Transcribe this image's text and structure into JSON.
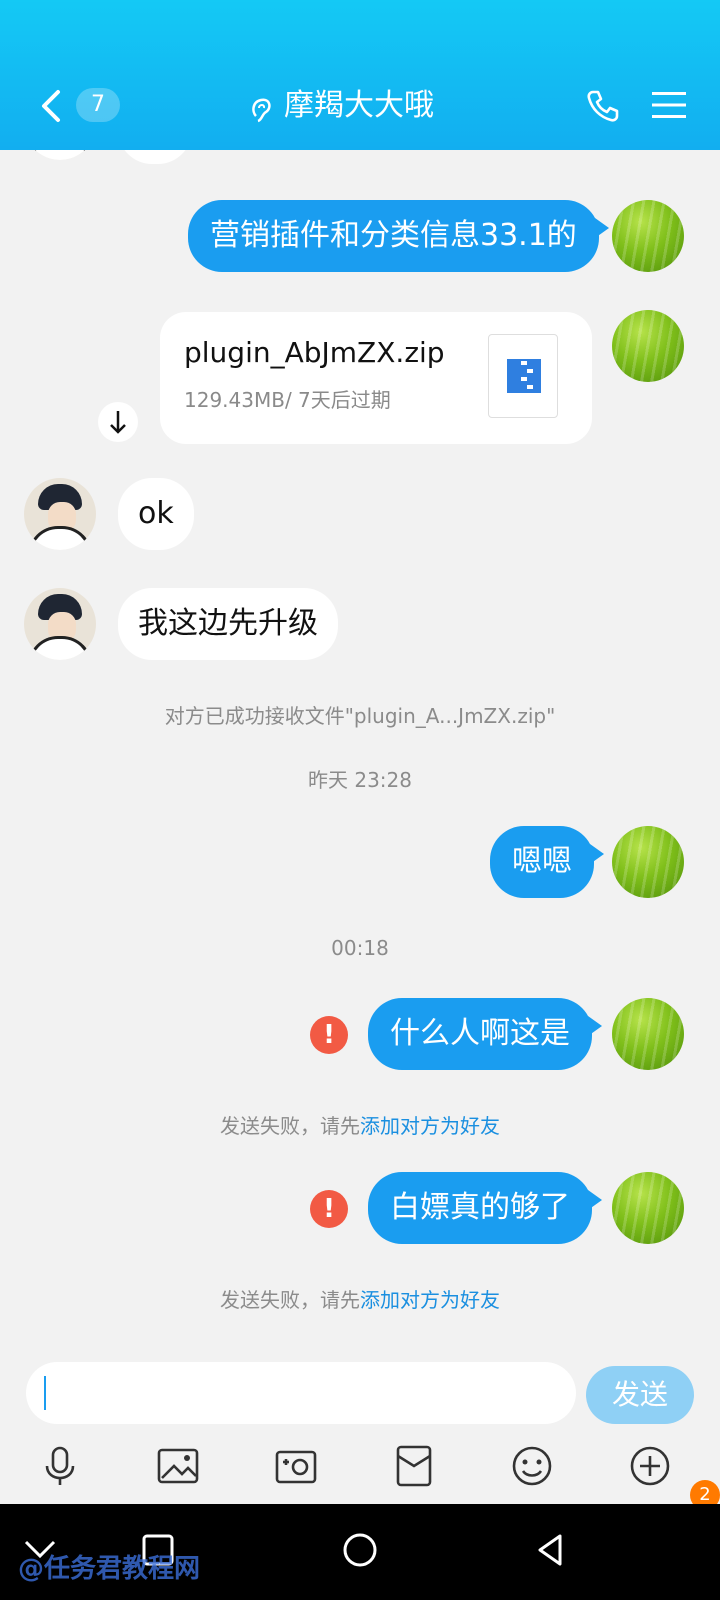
{
  "header": {
    "unread_count": "7",
    "title": "摩羯大大哦"
  },
  "messages": {
    "m1_out": "营销插件和分类信息33.1的",
    "file": {
      "name": "plugin_AbJmZX.zip",
      "meta": "129.43MB/ 7天后过期"
    },
    "m2_in": "ok",
    "m3_in": "我这边先升级",
    "sys_received": "对方已成功接收文件\"plugin_A...JmZX.zip\"",
    "time1": "昨天 23:28",
    "m4_out": "嗯嗯",
    "time2": "00:18",
    "m5_out": "什么人啊这是",
    "fail_prefix": "发送失败，请先",
    "fail_link": "添加对方为好友",
    "m6_out": "白嫖真的够了",
    "error_mark": "!"
  },
  "input": {
    "send_label": "发送",
    "tools": [
      "microphone-icon",
      "image-icon",
      "camera-icon",
      "red-packet-icon",
      "emoji-icon",
      "plus-icon"
    ]
  },
  "nav": {
    "watermark": "@任务君教程网",
    "notification_count": "2"
  },
  "colors": {
    "header": "#12aef0",
    "bubble_out": "#1a9df0",
    "send_button": "#8fd0f5",
    "error": "#f25a44",
    "link": "#1a8fe0"
  }
}
